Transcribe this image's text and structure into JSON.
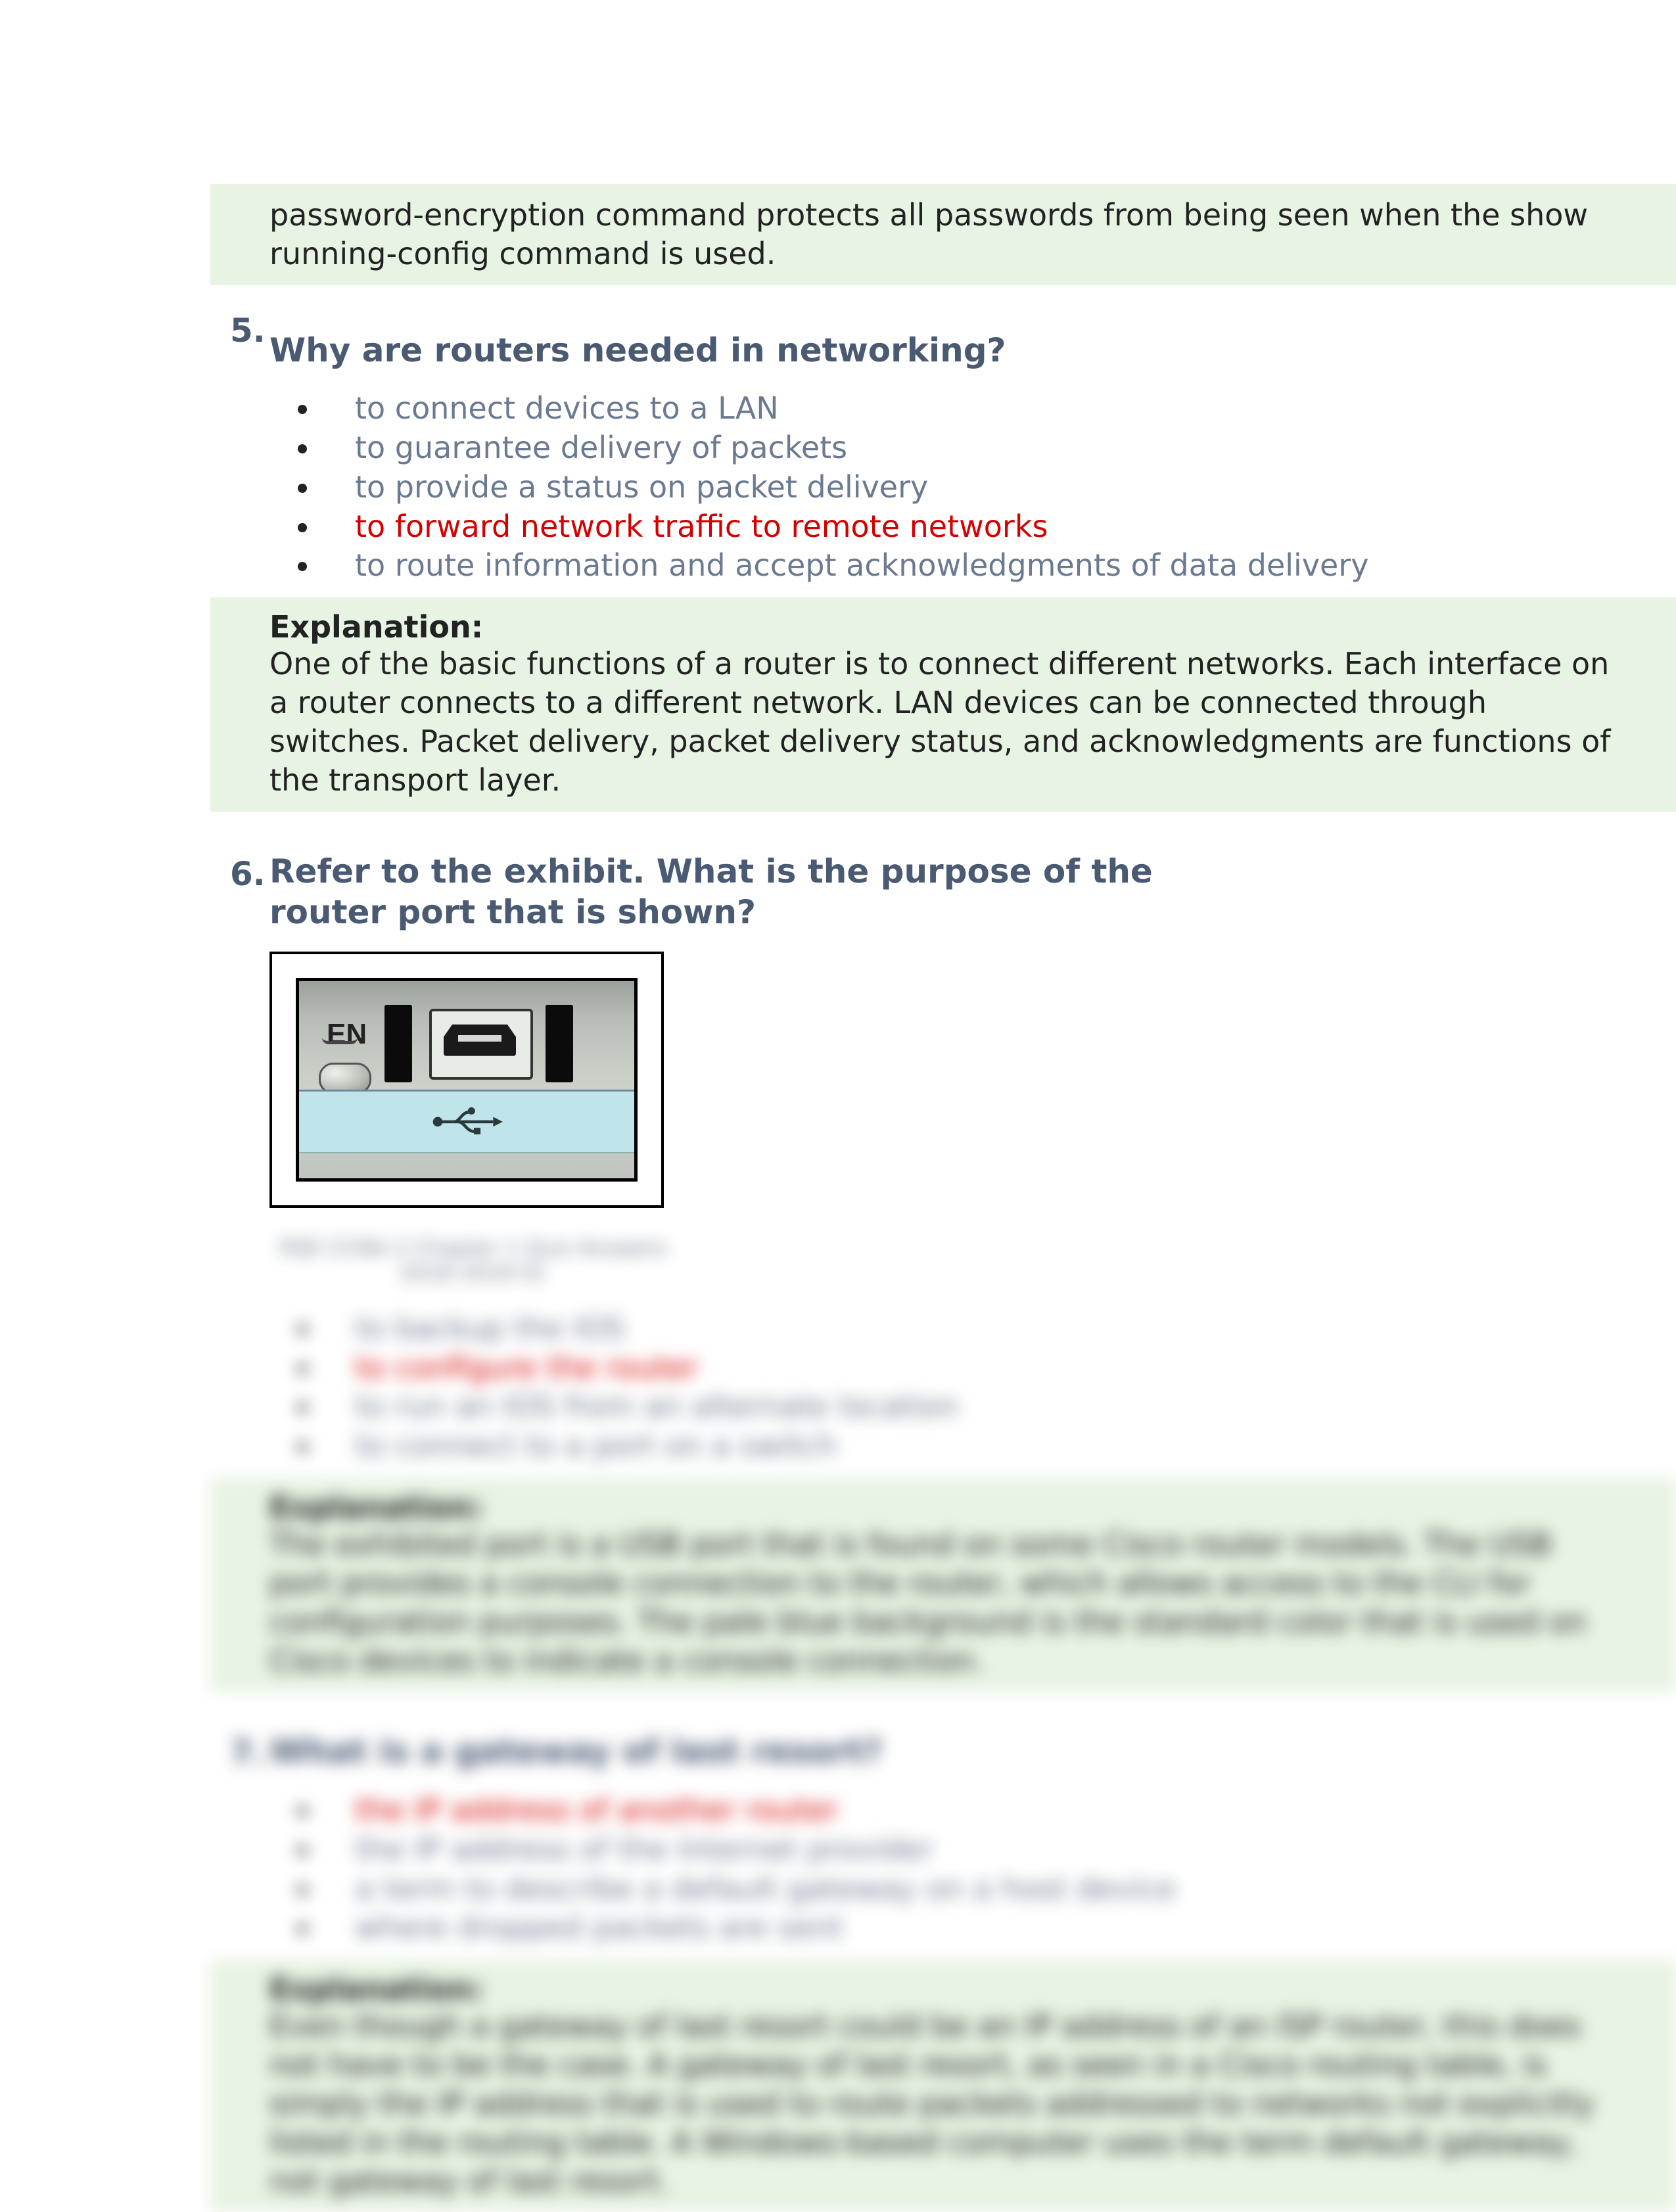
{
  "top_explain": {
    "text": "password-encryption command protects all passwords from being seen when the show running-config command is used."
  },
  "q5": {
    "number": "5.",
    "title": "Why are routers needed in networking?",
    "answers": [
      {
        "text": "to connect devices to a LAN",
        "correct": false
      },
      {
        "text": "to guarantee delivery of packets",
        "correct": false
      },
      {
        "text": "to provide a status on packet delivery",
        "correct": false
      },
      {
        "text": "to forward network traffic to remote networks",
        "correct": true
      },
      {
        "text": "to route information and accept acknowledgments of data delivery",
        "correct": false
      }
    ],
    "explain_label": "Explanation:",
    "explain_text": "One of the basic functions of a router is to connect different networks. Each interface on a router connects to a different network. LAN devices can be connected through switches. Packet delivery, packet delivery status, and acknowledgments are functions of the transport layer."
  },
  "q6": {
    "number": "6.",
    "title": "Refer to the exhibit. What is the purpose of the router port that is shown?",
    "exhibit": {
      "en_label": "EN",
      "caption": "RSE CCNA 2 Chapter 1 Quiz Answers 2018 2019 01"
    },
    "answers": [
      {
        "text": "to backup the IOS",
        "correct": false
      },
      {
        "text": "to configure the router",
        "correct": true
      },
      {
        "text": "to run an IOS from an alternate location",
        "correct": false
      },
      {
        "text": "to connect to a port on a switch",
        "correct": false
      }
    ],
    "explain_label": "Explanation:",
    "explain_text": "The exhibited port is a USB port that is found on some Cisco router models. The USB port provides a console connection to the router, which allows access to the CLI for configuration purposes. The pale blue background is the standard color that is used on Cisco devices to indicate a console connection."
  },
  "q7": {
    "number": "7.",
    "title": "What is a gateway of last resort?",
    "answers": [
      {
        "text": "the IP address of another router",
        "correct": true
      },
      {
        "text": "the IP address of the Internet provider",
        "correct": false
      },
      {
        "text": "a term to describe a default gateway on a host device",
        "correct": false
      },
      {
        "text": "where dropped packets are sent",
        "correct": false
      }
    ],
    "explain_label": "Explanation:",
    "explain_text": "Even though a gateway of last resort could be an IP address of an ISP router, this does not have to be the case. A gateway of last resort, as seen in a Cisco routing table, is simply the IP address that is used to route packets addressed to networks not explicitly listed in the routing table. A Windows-based computer uses the term default gateway, not gateway of last resort."
  }
}
